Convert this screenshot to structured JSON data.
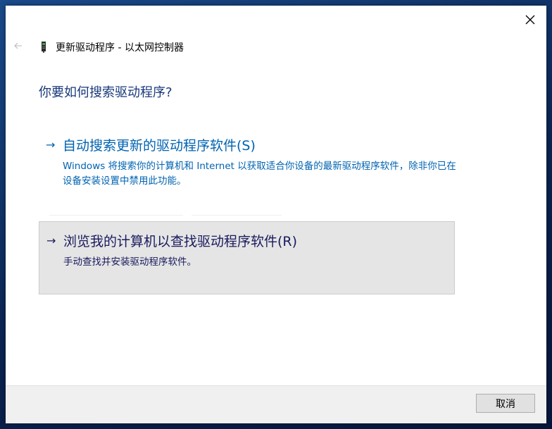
{
  "window": {
    "title": "更新驱动程序 - 以太网控制器",
    "close_icon": "close-icon",
    "back_icon": "back-arrow-icon",
    "title_icon": "network-adapter-icon"
  },
  "main": {
    "heading": "你要如何搜索驱动程序?",
    "options": [
      {
        "arrow": "→",
        "title": "自动搜索更新的驱动程序软件(S)",
        "description": "Windows 将搜索你的计算机和 Internet 以获取适合你设备的最新驱动程序软件，除非你已在设备安装设置中禁用此功能。"
      },
      {
        "arrow": "→",
        "title": "浏览我的计算机以查找驱动程序软件(R)",
        "description": "手动查找并安装驱动程序软件。"
      }
    ]
  },
  "footer": {
    "cancel_label": "取消"
  },
  "colors": {
    "link_blue": "#0063b1",
    "heading_blue": "#18387a",
    "hover_bg": "#e5e5e5",
    "footer_bg": "#f0f0f0"
  }
}
